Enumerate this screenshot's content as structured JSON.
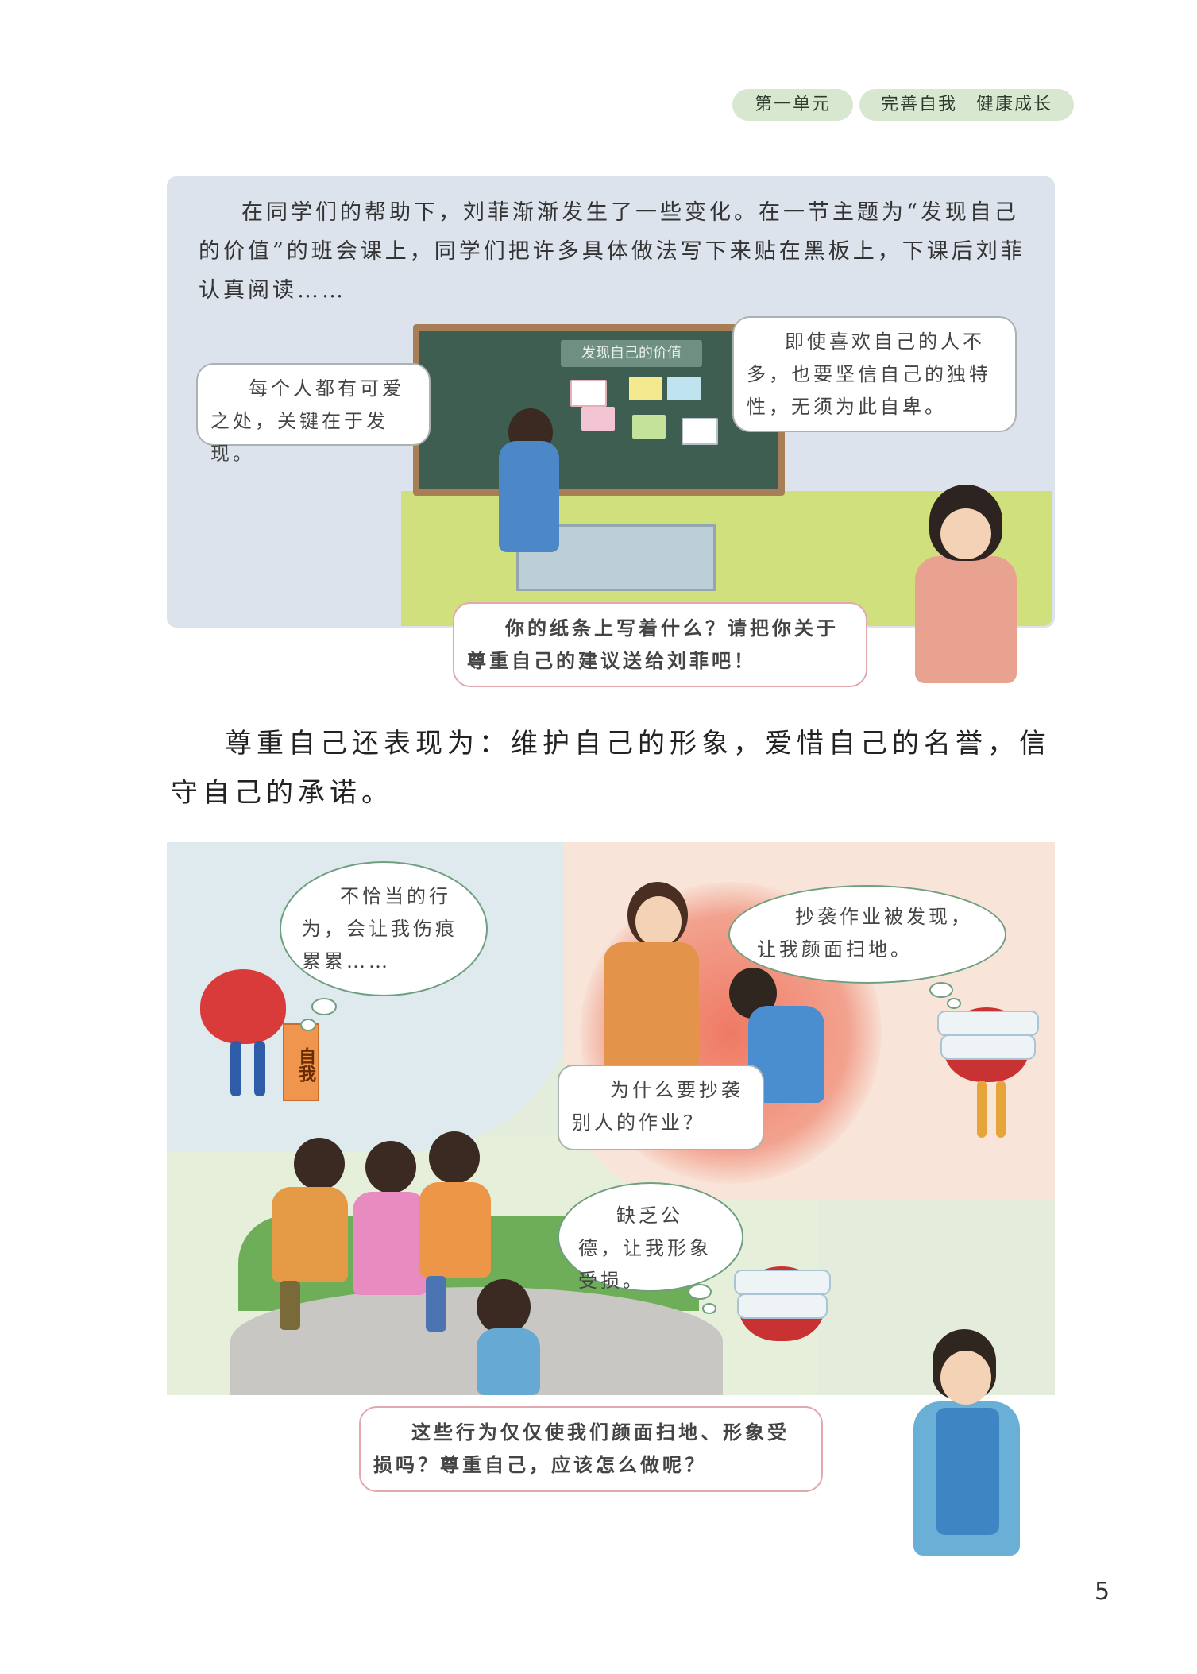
{
  "header": {
    "unit": "第一单元",
    "theme": "完善自我　健康成长"
  },
  "panel1": {
    "intro_lines": [
      "在同学们的帮助下，刘菲渐渐发生了一些变化。在一节主题为“发现自己的价值”的班会课上，同学们把许多具体做法写下来贴在黑板上，下课后刘菲认真阅读……"
    ],
    "board_title": "发现自己的价值",
    "bubble_left": "每个人都有可爱之处，关键在于发现。",
    "bubble_right": "即使喜欢自己的人不多，也要坚信自己的独特性，无须为此自卑。",
    "bubble_teacher": "你的纸条上写着什么？请把你关于尊重自己的建议送给刘菲吧！"
  },
  "body_text": "尊重自己还表现为：维护自己的形象，爱惜自己的名誉，信守自己的承诺。",
  "panel2": {
    "bubble_topleft": "不恰当的行为，会让我伤痕累累……",
    "card_label": "自我",
    "bubble_topright": "抄袭作业被发现，让我颜面扫地。",
    "bubble_teacher": "为什么要抄袭别人的作业？",
    "bubble_mid": "缺乏公德，让我形象受损。",
    "bubble_bottom": "这些行为仅仅使我们颜面扫地、形象受损吗？尊重自己，应该怎么做呢？"
  },
  "page_number": "5"
}
